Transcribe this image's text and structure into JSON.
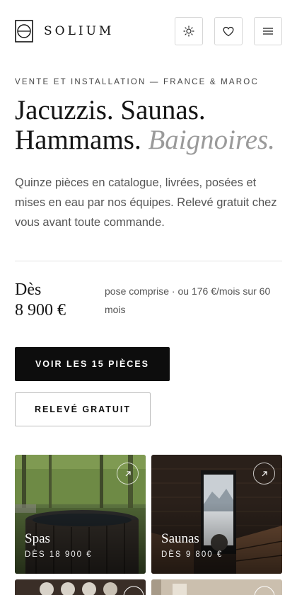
{
  "brand": {
    "name": "SOLIUM"
  },
  "header": {
    "icons": [
      "sun-icon",
      "heart-icon",
      "menu-icon"
    ]
  },
  "hero": {
    "eyebrow": "VENTE ET INSTALLATION — FRANCE & MAROC",
    "headline_line1": "Jacuzzis. Saunas.",
    "headline_line2": "Hammams.",
    "headline_alt": "Baignoires.",
    "intro": "Quinze pièces en catalogue, livrées, posées et mises en eau par nos équipes. Relevé gratuit chez vous avant toute commande."
  },
  "pricing": {
    "label": "Dès",
    "amount": "8 900 €",
    "note": "pose comprise · ou 176 €/mois sur 60 mois"
  },
  "actions": {
    "primary": "VOIR LES 15 PIÈCES",
    "secondary": "RELEVÉ GRATUIT"
  },
  "categories": [
    {
      "title": "Spas",
      "price": "DÈS 18 900 €"
    },
    {
      "title": "Saunas",
      "price": "DÈS 9 800 €"
    }
  ],
  "colors": {
    "primary_button": "#0d0d0d",
    "accent_text": "#9a9a9a"
  }
}
